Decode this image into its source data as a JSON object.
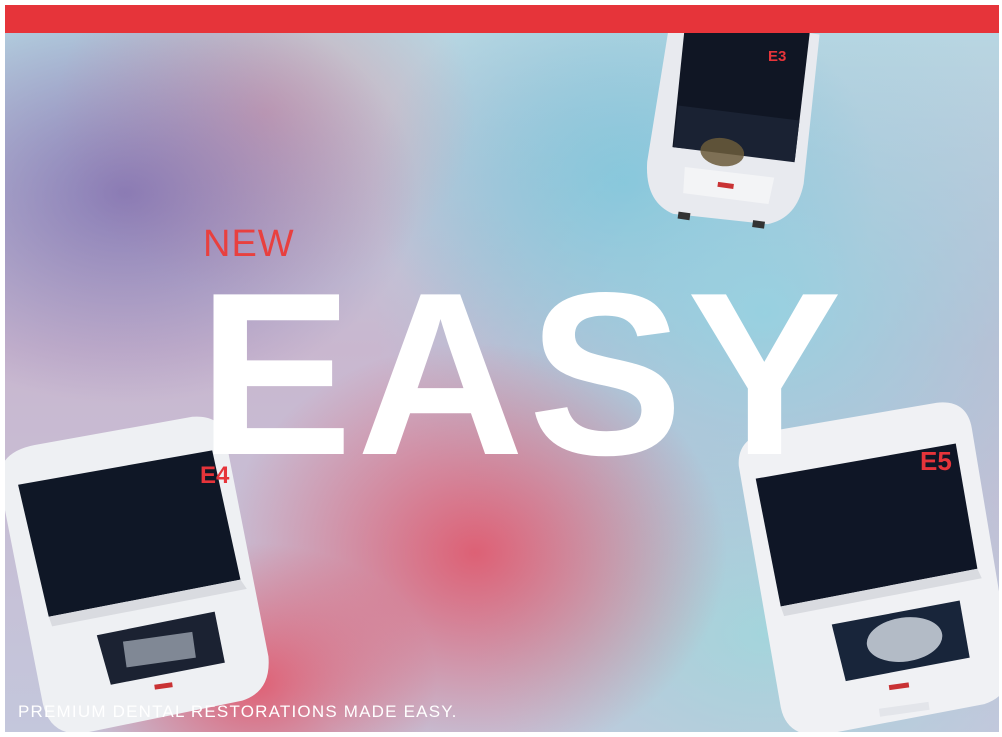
{
  "headline": {
    "new_label": "NEW",
    "easy_label": "EASY"
  },
  "tagline": "PREMIUM DENTAL RESTORATIONS MADE EASY.",
  "devices": [
    {
      "model": "E3",
      "icon": "milling-machine-icon"
    },
    {
      "model": "E4",
      "icon": "milling-machine-icon"
    },
    {
      "model": "E5",
      "icon": "milling-machine-icon"
    }
  ],
  "colors": {
    "brand_red": "#e6343a",
    "headline_white": "#ffffff",
    "new_red": "#e8403f"
  }
}
